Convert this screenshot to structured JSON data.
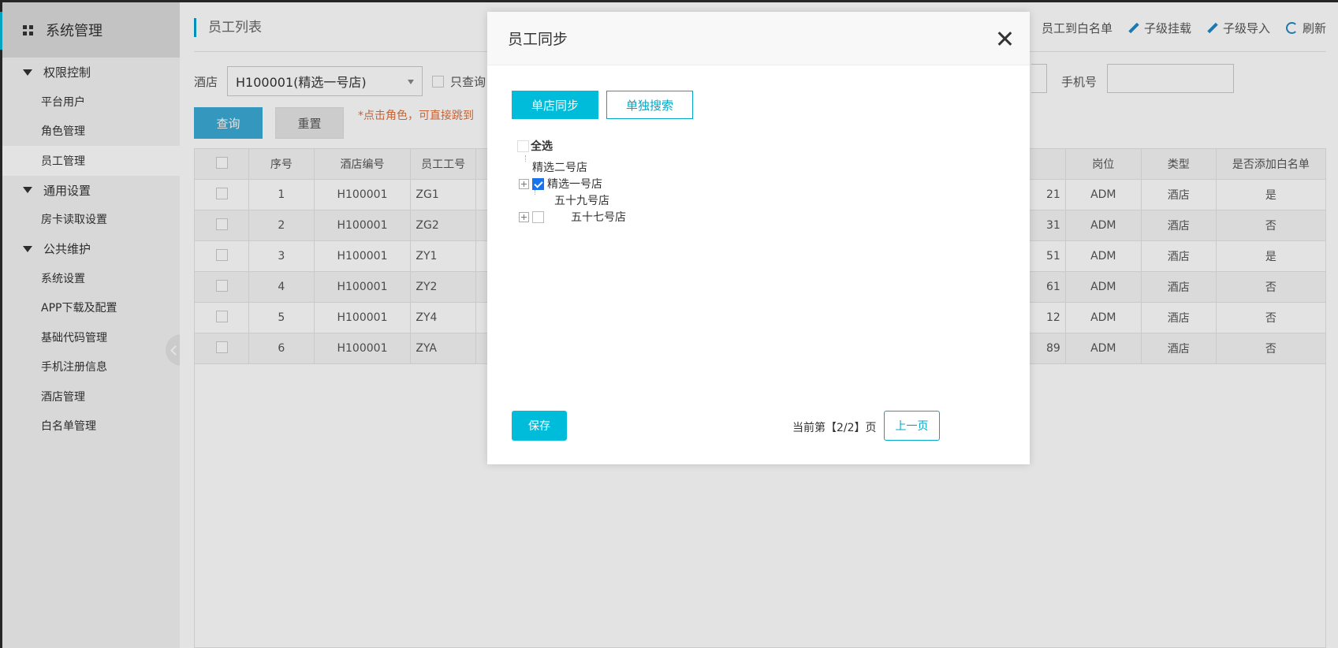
{
  "sidebar": {
    "title": "系统管理",
    "groups": [
      {
        "label": "权限控制",
        "items": [
          "平台用户",
          "角色管理",
          "员工管理"
        ]
      },
      {
        "label": "通用设置",
        "items": [
          "房卡读取设置"
        ]
      },
      {
        "label": "公共维护",
        "items": [
          "系统设置",
          "APP下载及配置",
          "基础代码管理",
          "手机注册信息",
          "酒店管理",
          "白名单管理"
        ]
      }
    ],
    "active_item": "员工管理"
  },
  "main": {
    "title": "员工列表",
    "toolbar": {
      "whitelist": "员工到白名单",
      "mount": "子级挂载",
      "import": "子级导入",
      "refresh": "刷新"
    },
    "filter": {
      "hotel_label": "酒店",
      "hotel_value": "H100001(精选一号店)",
      "only_label": "只查询",
      "phone_label": "手机号"
    },
    "buttons": {
      "query": "查询",
      "reset": "重置"
    },
    "hint": "*点击角色，可直接跳到",
    "table": {
      "headers": [
        "序号",
        "酒店编号",
        "员工工号",
        "岗位",
        "类型",
        "是否添加白名单"
      ],
      "rows": [
        {
          "no": "1",
          "hotel": "H100001",
          "emp": "ZG1",
          "tail": "21",
          "post": "ADM",
          "type": "酒店",
          "white": "是"
        },
        {
          "no": "2",
          "hotel": "H100001",
          "emp": "ZG2",
          "tail": "31",
          "post": "ADM",
          "type": "酒店",
          "white": "否"
        },
        {
          "no": "3",
          "hotel": "H100001",
          "emp": "ZY1",
          "tail": "51",
          "post": "ADM",
          "type": "酒店",
          "white": "是"
        },
        {
          "no": "4",
          "hotel": "H100001",
          "emp": "ZY2",
          "tail": "61",
          "post": "ADM",
          "type": "酒店",
          "white": "否"
        },
        {
          "no": "5",
          "hotel": "H100001",
          "emp": "ZY4",
          "tail": "12",
          "post": "ADM",
          "type": "酒店",
          "white": "否"
        },
        {
          "no": "6",
          "hotel": "H100001",
          "emp": "ZYA",
          "tail": "89",
          "post": "ADM",
          "type": "酒店",
          "white": "否"
        }
      ]
    }
  },
  "modal": {
    "title": "员工同步",
    "tabs": {
      "single": "单店同步",
      "search": "单独搜索"
    },
    "tree": {
      "select_all": "全选",
      "nodes": [
        "精选二号店",
        "精选一号店",
        "五十九号店",
        "五十七号店"
      ],
      "checked": [
        "精选一号店"
      ]
    },
    "save": "保存",
    "page_info": "当前第【2/2】页",
    "prev": "上一页"
  }
}
